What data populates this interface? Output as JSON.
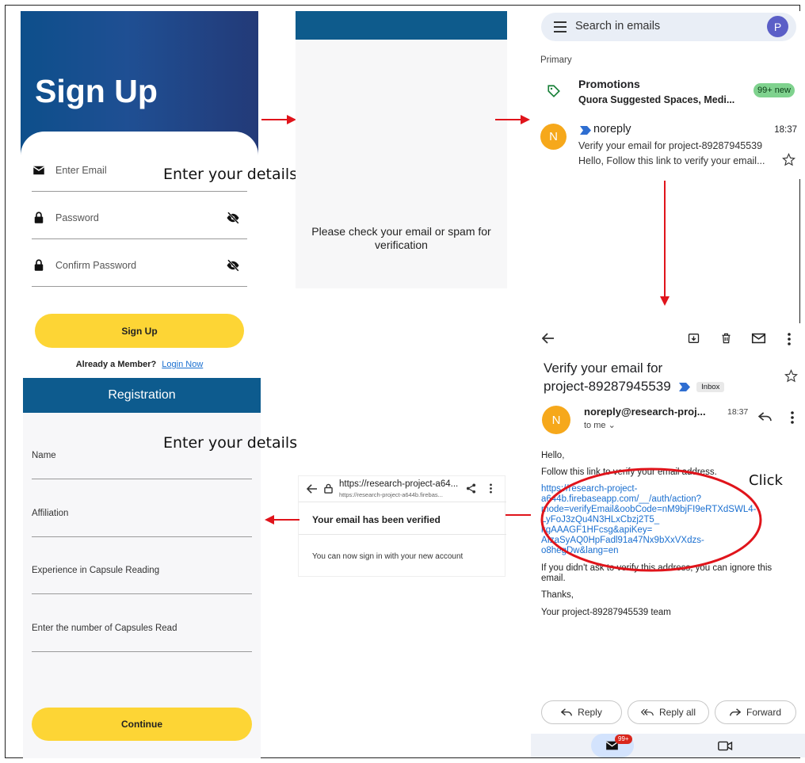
{
  "signup": {
    "title": "Sign Up",
    "email_placeholder": "Enter Email",
    "password_placeholder": "Password",
    "confirm_placeholder": "Confirm Password",
    "button": "Sign Up",
    "already_member": "Already a Member?",
    "login_link": "Login Now"
  },
  "annotations": {
    "details_1": "Enter your details",
    "details_2": "Enter your details",
    "click": "Click"
  },
  "verification": {
    "message": "Please check your email or spam for verification"
  },
  "inbox": {
    "search_placeholder": "Search in emails",
    "avatar": "P",
    "section": "Primary",
    "promotions": {
      "title": "Promotions",
      "subtitle": "Quora Suggested Spaces, Medi...",
      "badge": "99+ new"
    },
    "email": {
      "avatar": "N",
      "sender": "noreply",
      "time": "18:37",
      "subject": "Verify your email for project-89287945539",
      "preview": "Hello, Follow this link to verify your email..."
    }
  },
  "detail": {
    "subject_line1": "Verify your email for",
    "subject_line2": "project-89287945539",
    "label": "Inbox",
    "avatar": "N",
    "from": "noreply@research-proj...",
    "time": "18:37",
    "to": "to me",
    "greeting": "Hello,",
    "intro": "Follow this link to verify your email address.",
    "link_lines": [
      "https://research-project-",
      "a644b.firebaseapp.com/__/auth/action?",
      "mode=verifyEmail&oobCode=nM9bjFI9eRTXdSWL4-",
      "LyFoJ3zQu4N3HLxCbzj2T5_",
      "kgAAAGF1HFcsg&apiKey=",
      "AIzaSyAQ0HpFadl91a47Nx9bXxVXdzs-",
      "o8hegDw&lang=en"
    ],
    "ignore": "If you didn't ask to verify this address, you can ignore this email.",
    "thanks": "Thanks,",
    "team": "Your project-89287945539 team",
    "reply": "Reply",
    "reply_all": "Reply all",
    "forward": "Forward",
    "mail_badge": "99+"
  },
  "verified": {
    "url": "https://research-project-a64...",
    "url_sub": "https://research-project-a644b.firebas...",
    "title": "Your email has been verified",
    "body": "You can now sign in with your new account"
  },
  "registration": {
    "title": "Registration",
    "name": "Name",
    "affiliation": "Affiliation",
    "experience": "Experience in Capsule Reading",
    "capsules": "Enter the number of Capsules Read",
    "button": "Continue"
  },
  "colors": {
    "accent_yellow": "#fdd535",
    "header_blue": "#0d5b8e",
    "arrow_red": "#e0141b",
    "link_blue": "#1a6fd0"
  }
}
